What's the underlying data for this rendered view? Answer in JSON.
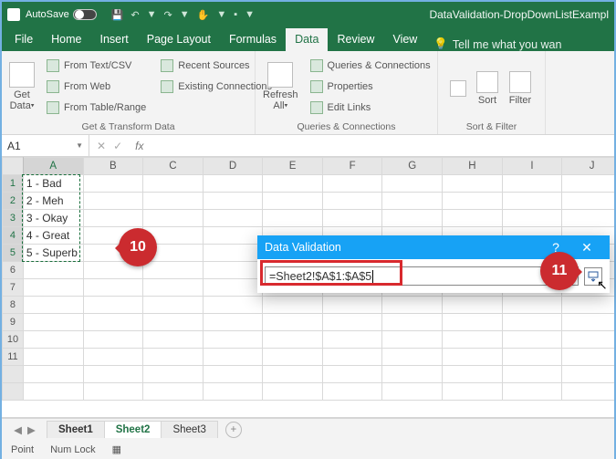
{
  "title": {
    "autosave": "AutoSave",
    "doc": "DataValidation-DropDownListExampl"
  },
  "qat": {
    "save": "💾",
    "undo": "↶",
    "redo": "↷",
    "touch": "✋",
    "more": "⋯"
  },
  "tabs": {
    "file": "File",
    "home": "Home",
    "insert": "Insert",
    "pagelayout": "Page Layout",
    "formulas": "Formulas",
    "data": "Data",
    "review": "Review",
    "view": "View",
    "tell": "Tell me what you wan"
  },
  "ribbon": {
    "getdata": {
      "label": "Get\nData",
      "fromtextcsv": "From Text/CSV",
      "fromweb": "From Web",
      "fromtable": "From Table/Range",
      "recent": "Recent Sources",
      "existing": "Existing Connections",
      "group": "Get & Transform Data"
    },
    "refresh": {
      "label": "Refresh\nAll",
      "queries": "Queries & Connections",
      "properties": "Properties",
      "editlinks": "Edit Links",
      "group": "Queries & Connections"
    },
    "sort": {
      "sort": "Sort",
      "filter": "Filter",
      "group": "Sort & Filter"
    }
  },
  "namebox": {
    "ref": "A1",
    "fx": "fx"
  },
  "cols": [
    "A",
    "B",
    "C",
    "D",
    "E",
    "F",
    "G",
    "H",
    "I",
    "J"
  ],
  "rows": [
    "1",
    "2",
    "3",
    "4",
    "5",
    "6",
    "7",
    "8",
    "9",
    "10",
    "11"
  ],
  "cells": {
    "A1": "1 - Bad",
    "A2": "2 - Meh",
    "A3": "3 - Okay",
    "A4": "4 - Great",
    "A5": "5 - Superb"
  },
  "sheets": {
    "s1": "Sheet1",
    "s2": "Sheet2",
    "s3": "Sheet3"
  },
  "status": {
    "mode": "Point",
    "numlock": "Num Lock"
  },
  "dialog": {
    "title": "Data Validation",
    "formula": "=Sheet2!$A$1:$A$5",
    "help": "?",
    "close": "✕"
  },
  "callouts": {
    "c10": "10",
    "c11": "11"
  }
}
